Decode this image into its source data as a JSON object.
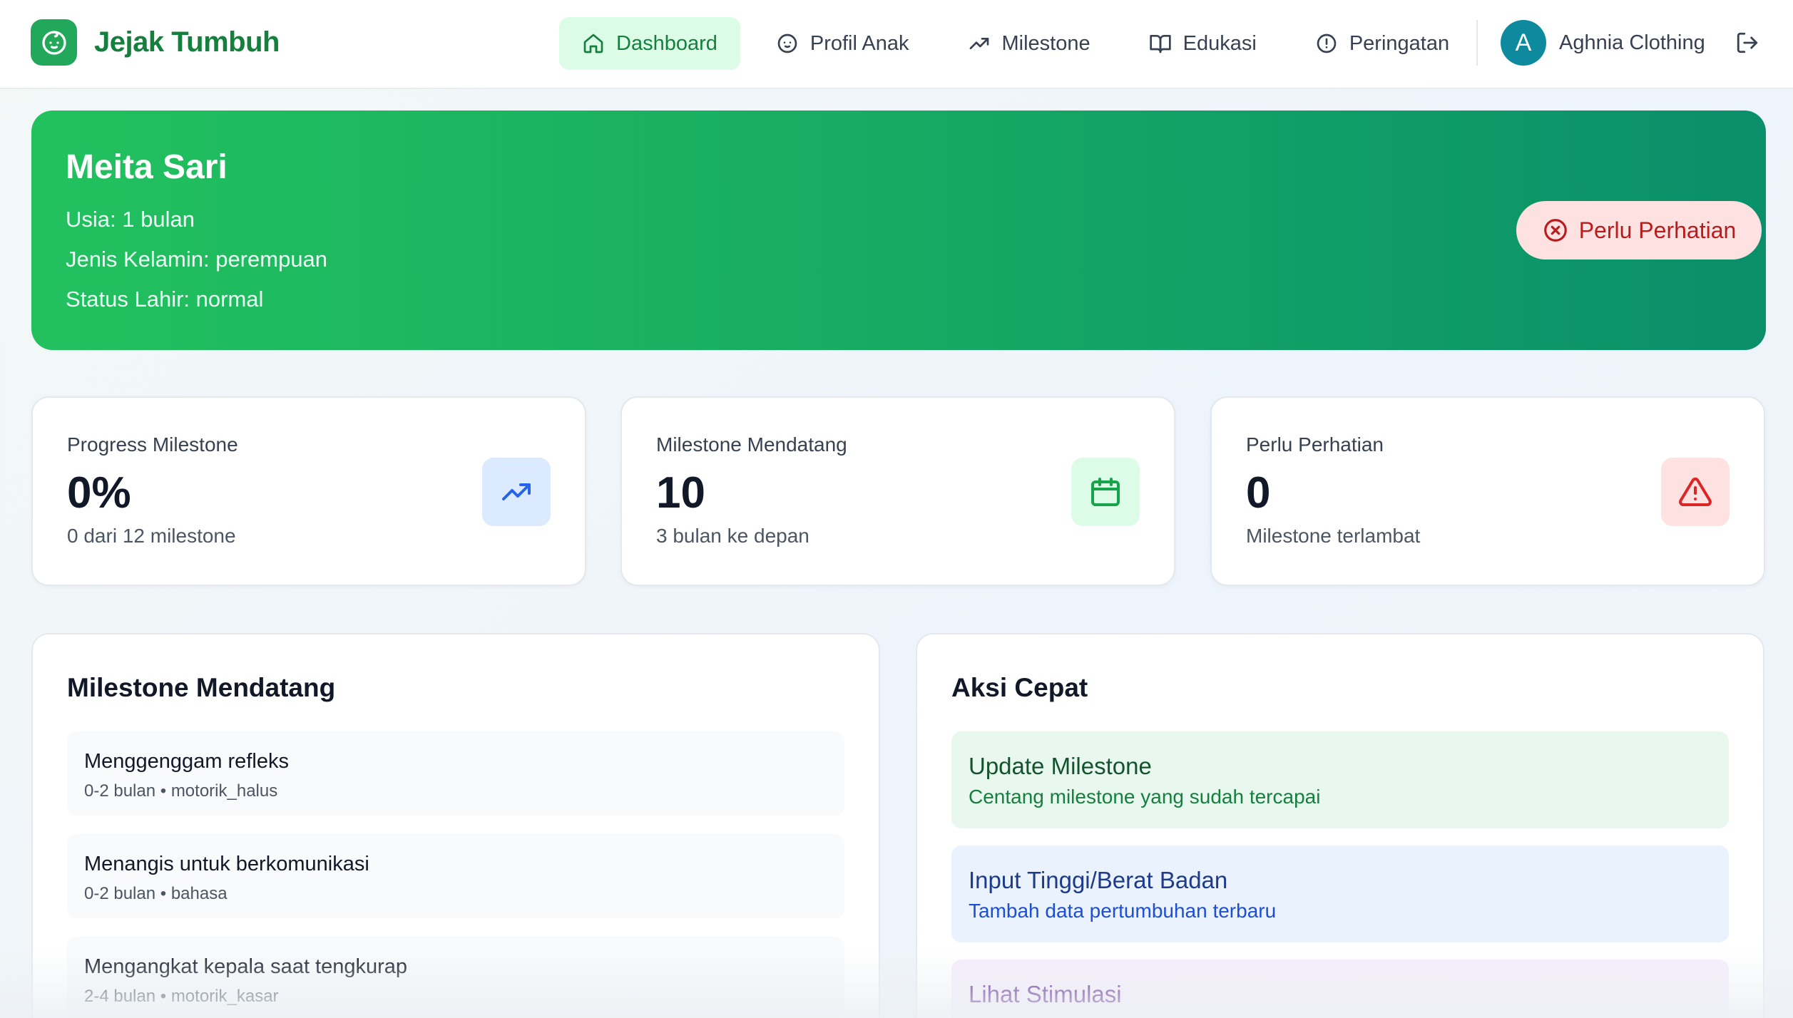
{
  "app": {
    "name": "Jejak Tumbuh",
    "logo_icon": "baby-face-icon"
  },
  "nav": {
    "items": [
      {
        "label": "Dashboard",
        "icon": "home-icon",
        "active": true
      },
      {
        "label": "Profil Anak",
        "icon": "baby-icon",
        "active": false
      },
      {
        "label": "Milestone",
        "icon": "trending-up-icon",
        "active": false
      },
      {
        "label": "Edukasi",
        "icon": "book-open-icon",
        "active": false
      },
      {
        "label": "Peringatan",
        "icon": "alert-circle-icon",
        "active": false
      }
    ]
  },
  "user": {
    "initial": "A",
    "name": "Aghnia Clothing",
    "logout_icon": "logout-icon"
  },
  "child": {
    "name": "Meita Sari",
    "age_line": "Usia: 1 bulan",
    "gender_line": "Jenis Kelamin: perempuan",
    "birth_status_line": "Status Lahir: normal",
    "status_badge": "Perlu Perhatian"
  },
  "stats": [
    {
      "label": "Progress Milestone",
      "value": "0%",
      "sub": "0 dari 12 milestone",
      "icon": "trending-up-icon",
      "color": "#2563eb",
      "bg": "#dbeafe"
    },
    {
      "label": "Milestone Mendatang",
      "value": "10",
      "sub": "3 bulan ke depan",
      "icon": "calendar-icon",
      "color": "#16a34a",
      "bg": "#dcfce7"
    },
    {
      "label": "Perlu Perhatian",
      "value": "0",
      "sub": "Milestone terlambat",
      "icon": "warning-triangle-icon",
      "color": "#dc2626",
      "bg": "#fee2e2"
    }
  ],
  "upcoming": {
    "title": "Milestone Mendatang",
    "items": [
      {
        "title": "Menggenggam refleks",
        "sub": "0-2 bulan • motorik_halus"
      },
      {
        "title": "Menangis untuk berkomunikasi",
        "sub": "0-2 bulan • bahasa"
      },
      {
        "title": "Mengangkat kepala saat tengkurap",
        "sub": "2-4 bulan • motorik_kasar"
      }
    ]
  },
  "quick_actions": {
    "title": "Aksi Cepat",
    "items": [
      {
        "title": "Update Milestone",
        "sub": "Centang milestone yang sudah tercapai",
        "bg": "#e8f8ee",
        "title_color": "#14532d",
        "sub_color": "#15803d"
      },
      {
        "title": "Input Tinggi/Berat Badan",
        "sub": "Tambah data pertumbuhan terbaru",
        "bg": "#eaf2fd",
        "title_color": "#1e3a8a",
        "sub_color": "#1d4ed8"
      },
      {
        "title": "Lihat Stimulasi",
        "sub": "",
        "bg": "#f5eefc",
        "title_color": "#581c87",
        "sub_color": "#7e22ce"
      }
    ]
  }
}
